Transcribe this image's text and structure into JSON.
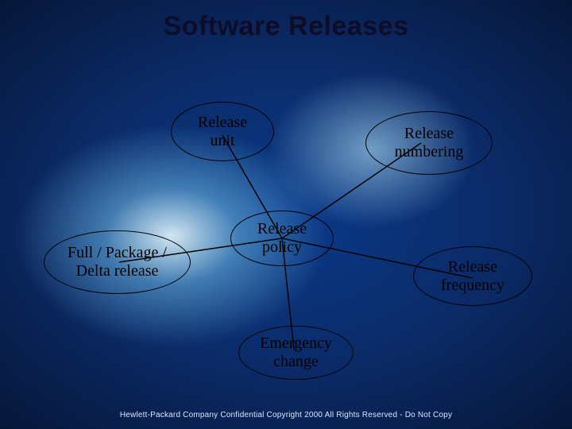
{
  "title": "Software Releases",
  "nodes": {
    "center": {
      "label": "Release\npolicy"
    },
    "top": {
      "label": "Release\nunit"
    },
    "right1": {
      "label": "Release\nnumbering"
    },
    "right2": {
      "label": "Release\nfrequency"
    },
    "bottom": {
      "label": "Emergency\nchange"
    },
    "left": {
      "label": "Full / Package /\nDelta release"
    }
  },
  "footer": "Hewlett-Packard Company Confidential Copyright 2000 All Rights Reserved - Do Not Copy"
}
